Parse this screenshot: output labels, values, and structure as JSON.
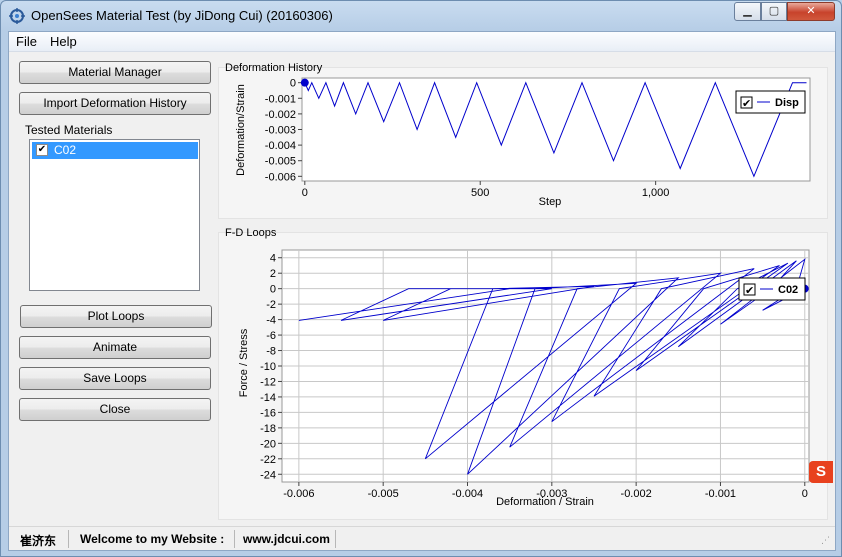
{
  "window": {
    "title": "OpenSees Material Test (by JiDong Cui) (20160306)"
  },
  "menu": {
    "file": "File",
    "help": "Help"
  },
  "buttons": {
    "material_manager": "Material Manager",
    "import_history": "Import Deformation History",
    "plot_loops": "Plot Loops",
    "animate": "Animate",
    "save_loops": "Save Loops",
    "close": "Close"
  },
  "tested_materials": {
    "label": "Tested Materials",
    "items": [
      {
        "label": "C02",
        "checked": true,
        "selected": true
      }
    ]
  },
  "deformation_plot": {
    "panel_title": "Deformation History",
    "chart_data": {
      "type": "line",
      "title": "Deformation History",
      "xlabel": "Step",
      "ylabel": "Deformation/Strain",
      "xlim": [
        -8,
        1440
      ],
      "ylim": [
        -0.0063,
        0.0003
      ],
      "xticks": [
        "0",
        "500",
        "1,000"
      ],
      "xtick_values": [
        0,
        500,
        1000
      ],
      "yticks": [
        "0",
        "-0.001",
        "-0.002",
        "-0.003",
        "-0.004",
        "-0.005",
        "-0.006"
      ],
      "ytick_values": [
        0,
        -0.001,
        -0.002,
        -0.003,
        -0.004,
        -0.005,
        -0.006
      ],
      "legend": {
        "label": "Disp",
        "checked": true,
        "position": "top-right"
      },
      "series": [
        {
          "name": "Disp",
          "color": "#0000cc",
          "x": [
            0,
            10,
            20,
            40,
            60,
            85,
            110,
            145,
            180,
            225,
            270,
            320,
            370,
            430,
            490,
            560,
            630,
            710,
            790,
            880,
            970,
            1070,
            1170,
            1280,
            1390,
            1430
          ],
          "y": [
            0,
            -0.0005,
            0,
            -0.001,
            0,
            -0.0015,
            0,
            -0.002,
            0,
            -0.0025,
            0,
            -0.003,
            0,
            -0.0035,
            0,
            -0.004,
            0,
            -0.0045,
            0,
            -0.005,
            0,
            -0.0055,
            0,
            -0.006,
            0,
            0
          ]
        }
      ],
      "marker": {
        "x": 0,
        "y": 0,
        "color": "#0000cc"
      }
    }
  },
  "fd_plot": {
    "panel_title": "F-D Loops",
    "chart_data": {
      "type": "line",
      "title": "F-D Loops",
      "xlabel": "Deformation / Strain",
      "ylabel": "Force  /  Stress",
      "xlim": [
        -0.0062,
        5e-05
      ],
      "ylim": [
        -25,
        5
      ],
      "grid": true,
      "xticks": [
        "-0.006",
        "-0.005",
        "-0.004",
        "-0.003",
        "-0.002",
        "-0.001",
        "0"
      ],
      "xtick_values": [
        -0.006,
        -0.005,
        -0.004,
        -0.003,
        -0.002,
        -0.001,
        0
      ],
      "yticks": [
        "4",
        "2",
        "0",
        "-2",
        "-4",
        "-6",
        "-8",
        "-10",
        "-12",
        "-14",
        "-16",
        "-18",
        "-20",
        "-22",
        "-24"
      ],
      "ytick_values": [
        4,
        2,
        0,
        -2,
        -4,
        -6,
        -8,
        -10,
        -12,
        -14,
        -16,
        -18,
        -20,
        -22,
        -24
      ],
      "legend": {
        "label": "C02",
        "checked": true,
        "position": "top-right"
      },
      "series": [
        {
          "name": "C02",
          "color": "#0000cc",
          "x": [
            0,
            -0.0005,
            -0.0001,
            0.0,
            -0.001,
            -0.0004,
            -0.0001,
            -0.0015,
            -0.0008,
            -0.0002,
            -0.002,
            -0.0012,
            -0.0003,
            -0.0025,
            -0.0017,
            -0.0006,
            -0.003,
            -0.0022,
            -0.001,
            -0.0035,
            -0.0027,
            -0.0015,
            -0.004,
            -0.0032,
            -0.002,
            -0.0045,
            -0.0037,
            -0.0025,
            -0.005,
            -0.0042,
            -0.003,
            -0.0055,
            -0.0047,
            -0.0035,
            -0.006
          ],
          "y": [
            0,
            -2.8,
            0,
            3.8,
            -4.6,
            0,
            3.6,
            -7.5,
            0,
            3.3,
            -10.6,
            0,
            3.0,
            -13.9,
            0,
            2.6,
            -17.2,
            0,
            2.0,
            -20.5,
            0,
            1.4,
            -24.0,
            0,
            0.7,
            -22.0,
            0,
            0.3,
            -4.1,
            0,
            0,
            -4.1,
            0,
            0,
            -4.1
          ]
        }
      ],
      "marker": {
        "x": 0,
        "y": 0,
        "color": "#0000cc"
      }
    }
  },
  "status": {
    "author": "崔济东",
    "welcome": "Welcome to my Website :",
    "website": "www.jdcui.com"
  },
  "tray": {
    "ime_icon": "S"
  }
}
